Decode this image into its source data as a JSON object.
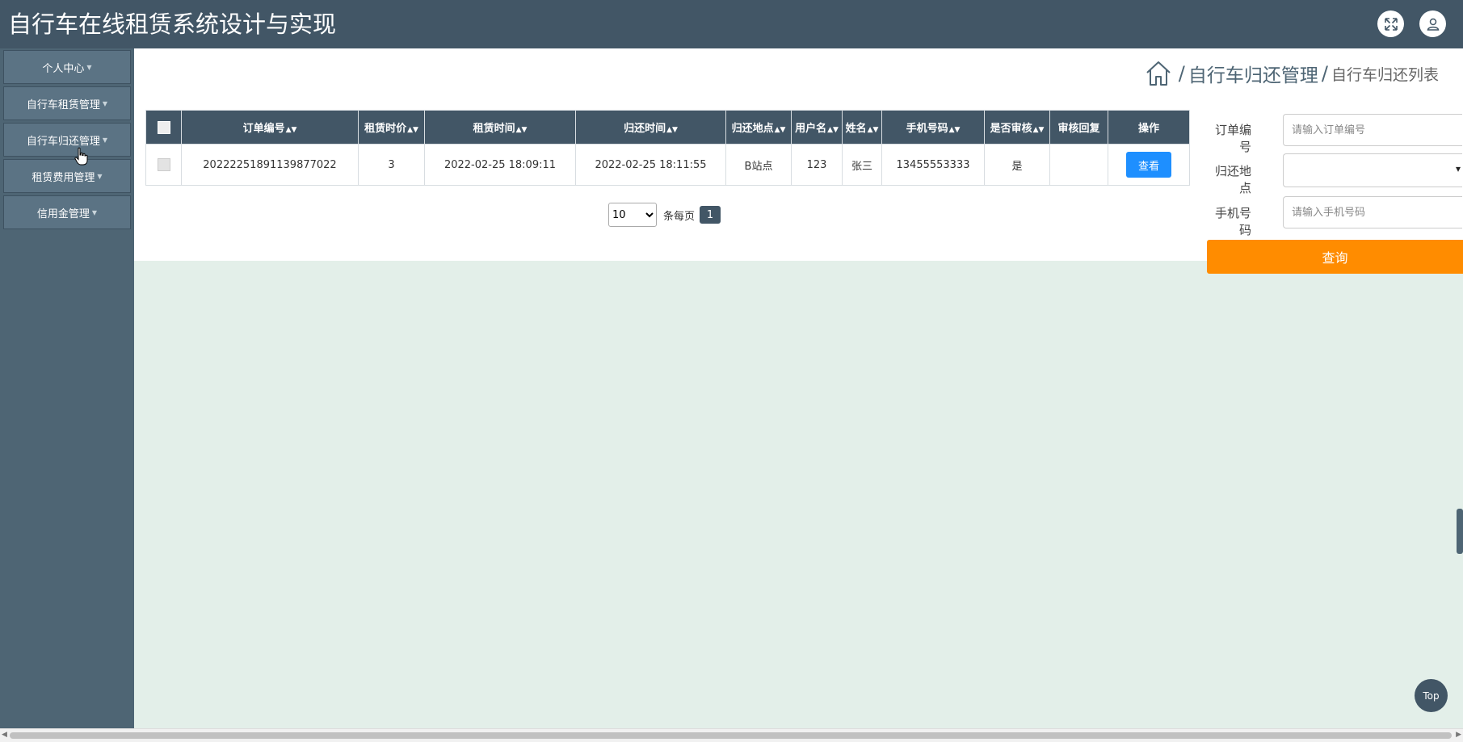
{
  "header": {
    "title": "自行车在线租赁系统设计与实现",
    "fullscreen_icon": "expand-icon",
    "user_icon": "user-icon"
  },
  "sidebar": {
    "items": [
      {
        "label": "个人中心"
      },
      {
        "label": "自行车租赁管理"
      },
      {
        "label": "自行车归还管理"
      },
      {
        "label": "租赁费用管理"
      },
      {
        "label": "信用金管理"
      }
    ]
  },
  "breadcrumb": {
    "home_icon": "home-icon",
    "sep": "/",
    "main": "自行车归还管理",
    "sub": "自行车归还列表"
  },
  "table": {
    "columns": [
      "订单编号",
      "租赁时价",
      "租赁时间",
      "归还时间",
      "归还地点",
      "用户名",
      "姓名",
      "手机号码",
      "是否审核",
      "审核回复",
      "操作"
    ],
    "rows": [
      {
        "order_no": "20222251891139877022",
        "price": "3",
        "rent_time": "2022-02-25 18:09:11",
        "return_time": "2022-02-25 18:11:55",
        "return_place": "B站点",
        "username": "123",
        "name": "张三",
        "phone": "13455553333",
        "reviewed": "是",
        "reply": "",
        "action_label": "查看"
      }
    ]
  },
  "pagination": {
    "page_size": "10",
    "per_page_label": "条每页",
    "current_page": "1"
  },
  "filter": {
    "order_label": "订单编号",
    "order_placeholder": "请输入订单编号",
    "place_label": "归还地点",
    "phone_label": "手机号码",
    "phone_placeholder": "请输入手机号码",
    "query_label": "查询"
  },
  "top_label": "Top",
  "colors": {
    "header": "#425666",
    "sidebar": "#4e6574",
    "query_button": "#ff8c00",
    "view_button": "#1e8fff"
  }
}
